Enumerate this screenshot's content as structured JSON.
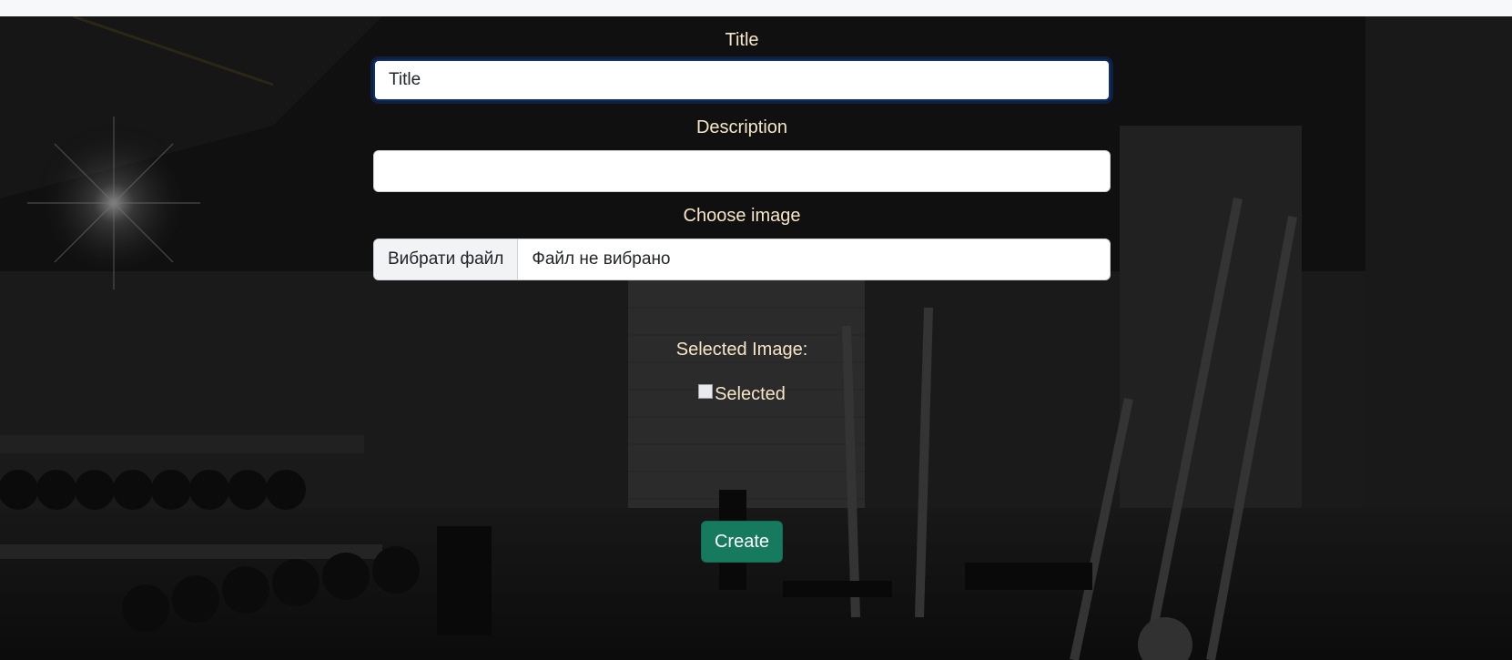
{
  "form": {
    "title_label": "Title",
    "title_value": "Title",
    "title_placeholder": "Title",
    "description_label": "Description",
    "description_value": "",
    "image_label": "Choose image",
    "file_button_label": "Вибрати файл",
    "file_status": "Файл не вибрано",
    "preview_label": "Selected Image:",
    "preview_alt": "Selected",
    "create_label": "Create"
  },
  "colors": {
    "label_text": "#f5e6c8",
    "create_button": "#167a5e",
    "focus_border": "#0d2f6b"
  },
  "icons": {
    "broken_image": "broken-image-icon"
  }
}
